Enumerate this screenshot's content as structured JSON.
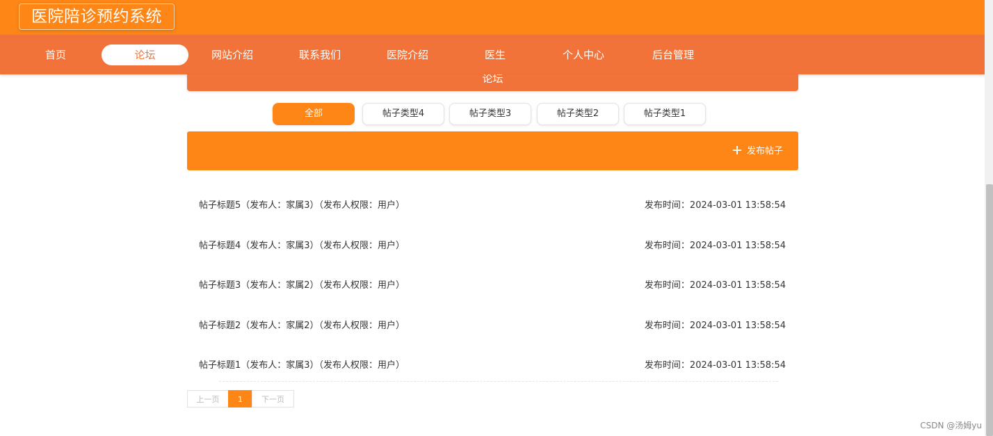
{
  "header": {
    "site_title": "医院陪诊预约系统"
  },
  "nav": {
    "items": [
      {
        "label": "首页"
      },
      {
        "label": "论坛"
      },
      {
        "label": "网站介绍"
      },
      {
        "label": "联系我们"
      },
      {
        "label": "医院介绍"
      },
      {
        "label": "医生"
      },
      {
        "label": "个人中心"
      },
      {
        "label": "后台管理"
      }
    ],
    "active": "论坛"
  },
  "forum": {
    "section_title": "论坛",
    "categories": [
      {
        "label": "全部"
      },
      {
        "label": "帖子类型4"
      },
      {
        "label": "帖子类型3"
      },
      {
        "label": "帖子类型2"
      },
      {
        "label": "帖子类型1"
      }
    ],
    "active_category": "全部",
    "publish_label": "发布帖子",
    "posts": [
      {
        "title": "帖子标题5（发布人：家属3）（发布人权限：用户）",
        "time": "发布时间：2024-03-01 13:58:54"
      },
      {
        "title": "帖子标题4（发布人：家属3）（发布人权限：用户）",
        "time": "发布时间：2024-03-01 13:58:54"
      },
      {
        "title": "帖子标题3（发布人：家属2）（发布人权限：用户）",
        "time": "发布时间：2024-03-01 13:58:54"
      },
      {
        "title": "帖子标题2（发布人：家属2）（发布人权限：用户）",
        "time": "发布时间：2024-03-01 13:58:54"
      },
      {
        "title": "帖子标题1（发布人：家属3）（发布人权限：用户）",
        "time": "发布时间：2024-03-01 13:58:54"
      }
    ]
  },
  "pagination": {
    "prev_label": "上一页",
    "current_page": "1",
    "next_label": "下一页"
  },
  "credit": "CSDN @汤姆yu",
  "colors": {
    "brand_orange": "#fd8616",
    "nav_orange": "#f2733a"
  }
}
